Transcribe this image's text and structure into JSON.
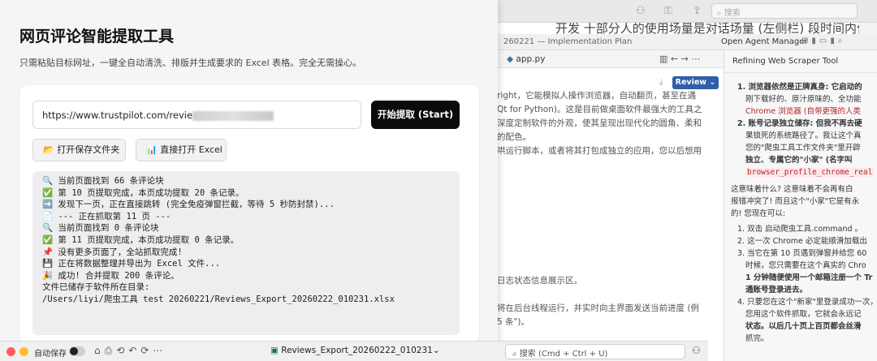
{
  "app": {
    "title": "网页评论智能提取工具",
    "subtitle": "只需粘贴目标网址，一键全自动清洗、排版并生成要求的 Excel 表格。完全无需操心。",
    "url_value": "https://www.trustpilot.com/revie",
    "start_label": "开始提取 (Start)",
    "open_folder_label": "打开保存文件夹",
    "open_folder_icon": "📂",
    "open_excel_label": "直接打开 Excel",
    "open_excel_icon": "📊",
    "log": [
      "🔍 当前页面找到 66 条评论块",
      "✅ 第 10 页提取完成，本页成功提取 20 条记录。",
      "➡️ 发现下一页，正在直接跳转 (完全免疫弹窗拦截，等待 5 秒防封禁)...",
      "",
      "📄 --- 正在抓取第 11 页 ---",
      "🔍 当前页面找到 0 条评论块",
      "✅ 第 11 页提取完成，本页成功提取 0 条记录。",
      "",
      "📌 没有更多页面了，全站抓取完成!",
      "💾 正在将数据整理并导出为 Excel 文件...",
      "🎉 成功! 合并提取 200 条评论。",
      "文件已储存于软件所在目录:",
      "/Users/liyi/爬虫工具 test 20260221/Reviews_Export_20260222_010231.xlsx"
    ]
  },
  "mac_toolbar": {
    "search_placeholder": "搜索",
    "strip_text": "开发  十部分人的使用场量是对话场量 (左侧栏)  段时间内作然"
  },
  "ide": {
    "window_title": "260221 — Implementation Plan",
    "agent_manager": "Open Agent Manager",
    "tab_file": "app.py",
    "review_label": "Review",
    "agent_title": "Refining Web Scraper Tool",
    "mid_lines": [
      "right，它能模拟人操作浏览器，自动翻页，甚至在遇",
      "",
      "Qt for Python)。这是目前做桌面软件最强大的工具之",
      "深度定制软件的外观，使其呈现出现代化的圆角、柔和",
      "的配色。",
      "哄运行脚本，或者将其打包成独立的应用，您以后想用"
    ],
    "mid_lines_lower": [
      "日志状态信息展示区。",
      "",
      "将在后台线程运行，并实时向主界面发送当前进度 (例",
      "5 条\")。"
    ],
    "right_lines": [
      "1. 浏览器依然是正牌真身: 它启动的",
      "刚下载好的、原汁原味的、全功能",
      "Chrome 浏览器 (自带更强的人类",
      "2. 账号记录独立储存: 但我不再去硬",
      "果锁死的系统路径了。我让这个真",
      "您的\"爬虫工具工作文件夹\"里开辟",
      "独立、专属它的\"小家\" (名字叫",
      "browser_profile_chrome_real",
      "这意味着什么? 这意味着不会再有白",
      "报错冲突了! 而且这个\"小家\"它是有永",
      "的! 您现在可以:",
      "1. 双击 启动爬虫工具.command 。",
      "2. 这一次 Chrome 必定能顺滑加载出",
      "3. 当它在第 10 页遇到弹窗并给您 60",
      "时候，您只需要在这个真实的 Chro",
      "1 分钟随便使用一个邮箱注册一个 Tr",
      "通账号登录进去。",
      "4. 只要您在这个\"新家\"里登录成功一次，",
      "您用这个软件抓取，它就会永远记",
      "状态。以后几十页上百页都会丝滑",
      "抓完。"
    ]
  },
  "bottom_bar": {
    "autosave_label": "自动保存",
    "file_name": "Reviews_Export_20260222_010231",
    "search_placeholder": "搜索 (Cmd + Ctrl + U)"
  },
  "colors": {
    "start_button_bg": "#0b0b0b",
    "review_button_bg": "#2f5fa7",
    "code_highlight": "#b3262e"
  }
}
